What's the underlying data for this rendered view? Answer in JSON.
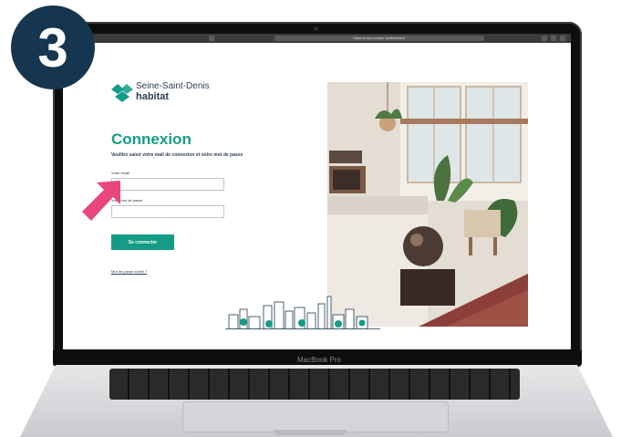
{
  "step": {
    "number": "3"
  },
  "browser": {
    "url": "https://mon-compte.ssdhabitat.fr"
  },
  "brand": {
    "name_line1": "Seine-Saint-Denis",
    "name_line2": "habitat",
    "accent": "#159c86",
    "navy": "#16364f"
  },
  "login": {
    "title": "Connexion",
    "subtitle": "Veuillez saisir votre mail de connexion et votre mot de passe",
    "email_label": "Votre email",
    "email_value": "",
    "password_label": "Votre mot de passe",
    "password_value": "",
    "submit_label": "Se connecter",
    "forgot_label": "Mot de passe oublié ?"
  },
  "laptop": {
    "model": "MacBook Pro"
  },
  "icons": {
    "step_badge": "circle-badge",
    "pointer": "pink-arrow-icon",
    "logo": "ssd-habitat-logo-icon"
  }
}
